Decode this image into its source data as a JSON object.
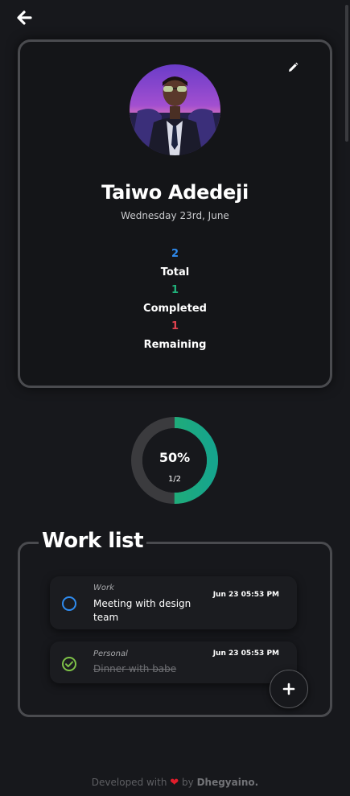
{
  "profile": {
    "name": "Taiwo Adedeji",
    "date": "Wednesday 23rd, June",
    "stats": [
      {
        "value": "2",
        "label": "Total",
        "color": "#2f8cf0"
      },
      {
        "value": "1",
        "label": "Completed",
        "color": "#20b07a"
      },
      {
        "value": "1",
        "label": "Remaining",
        "color": "#e1424f"
      }
    ]
  },
  "progress": {
    "percent_label": "50%",
    "fraction_label": "1/2",
    "fraction": 0.5,
    "track_color": "#3b3b3e",
    "fill_color": "#22b079"
  },
  "work_list": {
    "title": "Work list",
    "tasks": [
      {
        "category": "Work",
        "title": "Meeting with design team",
        "time": "Jun 23 05:53 PM",
        "completed": false
      },
      {
        "category": "Personal",
        "title": "Dinner with babe",
        "time": "Jun 23 05:53 PM",
        "completed": true
      }
    ]
  },
  "icons": {
    "back": "arrow-left-icon",
    "edit": "pencil-icon",
    "add": "plus-icon",
    "pending": "circle-outline-icon",
    "done": "check-circle-icon"
  },
  "footer": {
    "prefix": "Developed with",
    "by": "by",
    "author": "Dhegyaino."
  }
}
